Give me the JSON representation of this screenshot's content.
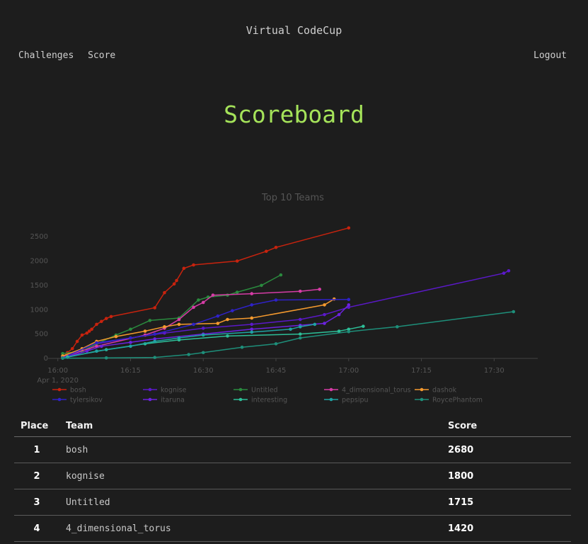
{
  "header": {
    "brand": "Virtual CodeCup"
  },
  "nav": {
    "challenges": "Challenges",
    "score": "Score",
    "logout": "Logout"
  },
  "page_title": "Scoreboard",
  "chart_data": {
    "type": "line",
    "title": "Top 10 Teams",
    "x_ticks": [
      "16:00",
      "16:15",
      "16:30",
      "16:45",
      "17:00",
      "17:15",
      "17:30"
    ],
    "x_sublabel": "Apr 1, 2020",
    "x_unit": "minutes after 16:00",
    "y_ticks": [
      0,
      500,
      1000,
      1500,
      2000,
      2500
    ],
    "xlim": [
      -2,
      99
    ],
    "ylim": [
      0,
      2750
    ],
    "series": [
      {
        "name": "bosh",
        "color": "#c8230e",
        "points": [
          [
            1,
            30
          ],
          [
            2,
            120
          ],
          [
            3,
            200
          ],
          [
            4,
            350
          ],
          [
            5,
            480
          ],
          [
            6,
            520
          ],
          [
            6.5,
            560
          ],
          [
            7,
            600
          ],
          [
            8,
            700
          ],
          [
            9,
            760
          ],
          [
            10,
            820
          ],
          [
            11,
            860
          ],
          [
            20,
            1040
          ],
          [
            22,
            1350
          ],
          [
            24,
            1530
          ],
          [
            24.5,
            1600
          ],
          [
            26,
            1850
          ],
          [
            28,
            1920
          ],
          [
            37,
            2000
          ],
          [
            43,
            2200
          ],
          [
            45,
            2280
          ],
          [
            60,
            2680
          ]
        ]
      },
      {
        "name": "kognise",
        "color": "#5b19c9",
        "points": [
          [
            1,
            20
          ],
          [
            6,
            150
          ],
          [
            8,
            300
          ],
          [
            15,
            420
          ],
          [
            22,
            520
          ],
          [
            30,
            620
          ],
          [
            40,
            700
          ],
          [
            50,
            800
          ],
          [
            55,
            900
          ],
          [
            60,
            1050
          ],
          [
            92,
            1750
          ],
          [
            93,
            1800
          ]
        ]
      },
      {
        "name": "Untitled",
        "color": "#2a8a3e",
        "points": [
          [
            1,
            100
          ],
          [
            5,
            150
          ],
          [
            8,
            300
          ],
          [
            12,
            480
          ],
          [
            15,
            600
          ],
          [
            19,
            780
          ],
          [
            25,
            830
          ],
          [
            29,
            1200
          ],
          [
            31,
            1260
          ],
          [
            35,
            1300
          ],
          [
            37,
            1360
          ],
          [
            42,
            1500
          ],
          [
            46,
            1715
          ]
        ]
      },
      {
        "name": "4_dimensional_torus",
        "color": "#d63ca6",
        "points": [
          [
            1,
            30
          ],
          [
            8,
            250
          ],
          [
            18,
            480
          ],
          [
            22,
            620
          ],
          [
            25,
            800
          ],
          [
            28,
            1050
          ],
          [
            30,
            1150
          ],
          [
            32,
            1300
          ],
          [
            40,
            1330
          ],
          [
            50,
            1380
          ],
          [
            54,
            1420
          ]
        ]
      },
      {
        "name": "dashok",
        "color": "#f59a2e",
        "points": [
          [
            1,
            50
          ],
          [
            5,
            200
          ],
          [
            8,
            350
          ],
          [
            12,
            450
          ],
          [
            18,
            560
          ],
          [
            22,
            650
          ],
          [
            25,
            700
          ],
          [
            33,
            720
          ],
          [
            35,
            800
          ],
          [
            40,
            830
          ],
          [
            55,
            1100
          ],
          [
            57,
            1220
          ]
        ]
      },
      {
        "name": "tylersikov",
        "color": "#2f22c8",
        "points": [
          [
            1,
            10
          ],
          [
            8,
            320
          ],
          [
            15,
            420
          ],
          [
            20,
            500
          ],
          [
            28,
            700
          ],
          [
            33,
            870
          ],
          [
            36,
            980
          ],
          [
            40,
            1100
          ],
          [
            45,
            1200
          ],
          [
            60,
            1210
          ]
        ]
      },
      {
        "name": "itaruna",
        "color": "#6c22e0",
        "points": [
          [
            2,
            20
          ],
          [
            9,
            250
          ],
          [
            15,
            330
          ],
          [
            20,
            400
          ],
          [
            30,
            500
          ],
          [
            40,
            600
          ],
          [
            50,
            680
          ],
          [
            55,
            720
          ],
          [
            58,
            900
          ],
          [
            60,
            1100
          ]
        ]
      },
      {
        "name": "interesting",
        "color": "#2dbf98",
        "points": [
          [
            2,
            30
          ],
          [
            10,
            180
          ],
          [
            18,
            300
          ],
          [
            25,
            380
          ],
          [
            35,
            460
          ],
          [
            50,
            500
          ],
          [
            58,
            560
          ],
          [
            60,
            600
          ],
          [
            63,
            660
          ]
        ]
      },
      {
        "name": "pepsipu",
        "color": "#1fa3a3",
        "points": [
          [
            1,
            5
          ],
          [
            8,
            150
          ],
          [
            15,
            250
          ],
          [
            20,
            350
          ],
          [
            25,
            420
          ],
          [
            30,
            480
          ],
          [
            40,
            540
          ],
          [
            48,
            600
          ],
          [
            50,
            650
          ],
          [
            53,
            700
          ]
        ]
      },
      {
        "name": "RoycePhantom",
        "color": "#1e8f7a",
        "points": [
          [
            1,
            5
          ],
          [
            10,
            10
          ],
          [
            20,
            20
          ],
          [
            27,
            80
          ],
          [
            30,
            120
          ],
          [
            38,
            230
          ],
          [
            45,
            300
          ],
          [
            50,
            420
          ],
          [
            60,
            550
          ],
          [
            70,
            650
          ],
          [
            94,
            960
          ]
        ]
      }
    ]
  },
  "table": {
    "headers": {
      "place": "Place",
      "team": "Team",
      "score": "Score"
    },
    "rows": [
      {
        "place": "1",
        "team": "bosh",
        "score": "2680"
      },
      {
        "place": "2",
        "team": "kognise",
        "score": "1800"
      },
      {
        "place": "3",
        "team": "Untitled",
        "score": "1715"
      },
      {
        "place": "4",
        "team": "4_dimensional_torus",
        "score": "1420"
      }
    ]
  }
}
